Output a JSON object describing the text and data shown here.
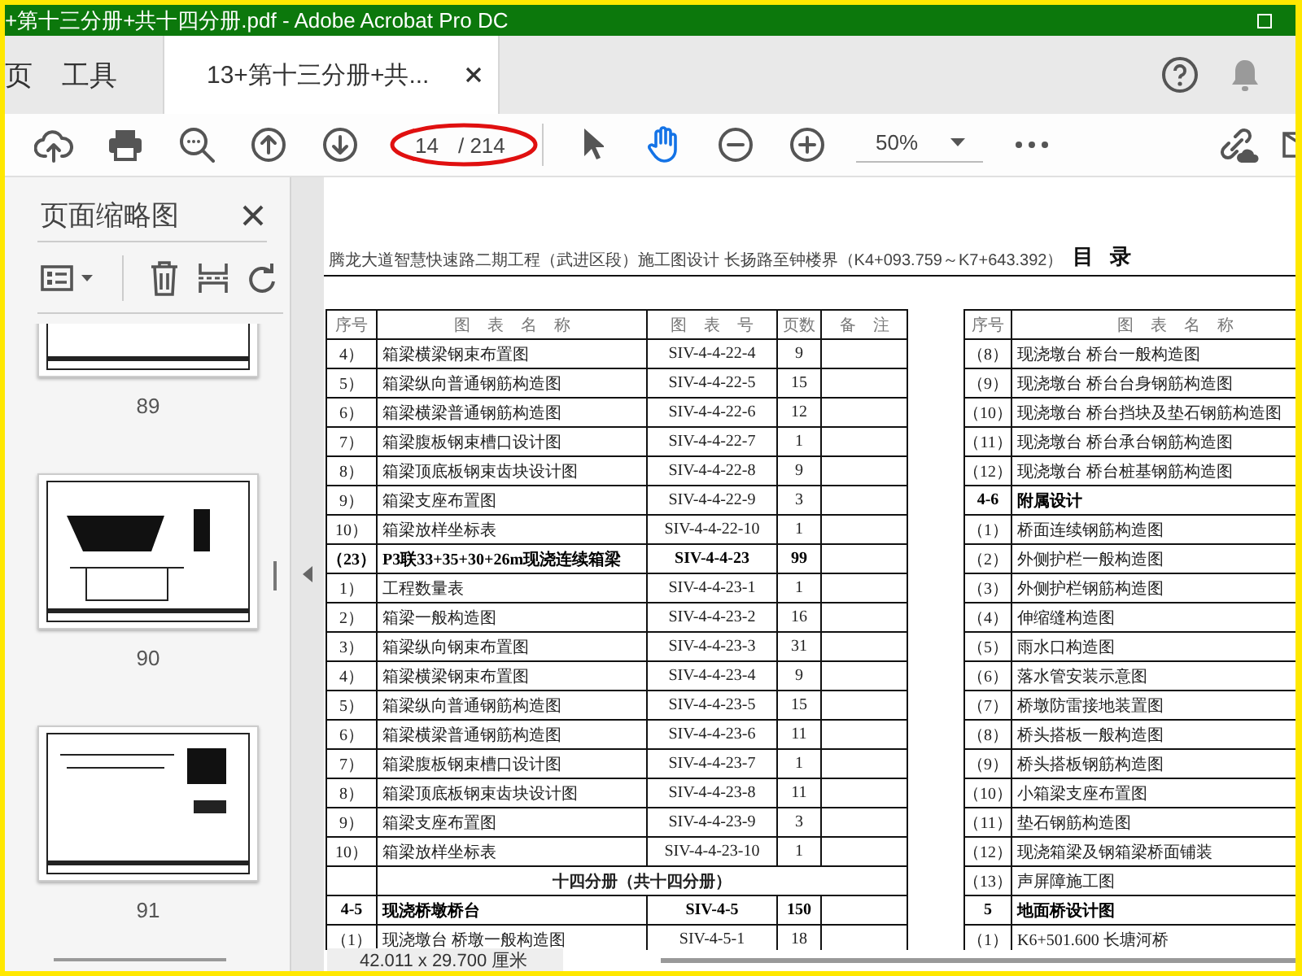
{
  "window": {
    "title": "+第十三分册+共十四分册.pdf - Adobe Acrobat Pro DC"
  },
  "tabs": [
    {
      "label": "页",
      "selected": false
    },
    {
      "label": "工具",
      "selected": false
    },
    {
      "label": "13+第十三分册+共...",
      "selected": true
    }
  ],
  "toolbar": {
    "page_current": "14",
    "page_total": "/ 214",
    "zoom": "50%"
  },
  "thumbnails_panel": {
    "title": "页面缩略图",
    "pages": [
      {
        "label": "89"
      },
      {
        "label": "90"
      },
      {
        "label": "91"
      }
    ]
  },
  "document": {
    "header": "腾龙大道智慧快速路二期工程（武进区段）施工图设计 长扬路至钟楼界（K4+093.759～K7+643.392）",
    "header_title": "目 录",
    "left_table": {
      "columns": [
        "序号",
        "图 表 名 称",
        "图 表 号",
        "页数",
        "备 注"
      ],
      "rows": [
        {
          "kind": "item",
          "seq": "4）",
          "name": "箱梁横梁钢束布置图",
          "code": "SIV-4-4-22-4",
          "pages": "9"
        },
        {
          "kind": "item",
          "seq": "5）",
          "name": "箱梁纵向普通钢筋构造图",
          "code": "SIV-4-4-22-5",
          "pages": "15"
        },
        {
          "kind": "item",
          "seq": "6）",
          "name": "箱梁横梁普通钢筋构造图",
          "code": "SIV-4-4-22-6",
          "pages": "12"
        },
        {
          "kind": "item",
          "seq": "7）",
          "name": "箱梁腹板钢束槽口设计图",
          "code": "SIV-4-4-22-7",
          "pages": "1"
        },
        {
          "kind": "item",
          "seq": "8）",
          "name": "箱梁顶底板钢束齿块设计图",
          "code": "SIV-4-4-22-8",
          "pages": "9"
        },
        {
          "kind": "item",
          "seq": "9）",
          "name": "箱梁支座布置图",
          "code": "SIV-4-4-22-9",
          "pages": "3"
        },
        {
          "kind": "item",
          "seq": "10）",
          "name": "箱梁放样坐标表",
          "code": "SIV-4-4-22-10",
          "pages": "1"
        },
        {
          "kind": "section",
          "seq": "（23）",
          "name": "P3联33+35+30+26m现浇连续箱梁",
          "code": "SIV-4-4-23",
          "pages": "99"
        },
        {
          "kind": "item",
          "seq": "1）",
          "name": "工程数量表",
          "code": "SIV-4-4-23-1",
          "pages": "1"
        },
        {
          "kind": "item",
          "seq": "2）",
          "name": "箱梁一般构造图",
          "code": "SIV-4-4-23-2",
          "pages": "16"
        },
        {
          "kind": "item",
          "seq": "3）",
          "name": "箱梁纵向钢束布置图",
          "code": "SIV-4-4-23-3",
          "pages": "31"
        },
        {
          "kind": "item",
          "seq": "4）",
          "name": "箱梁横梁钢束布置图",
          "code": "SIV-4-4-23-4",
          "pages": "9"
        },
        {
          "kind": "item",
          "seq": "5）",
          "name": "箱梁纵向普通钢筋构造图",
          "code": "SIV-4-4-23-5",
          "pages": "15"
        },
        {
          "kind": "item",
          "seq": "6）",
          "name": "箱梁横梁普通钢筋构造图",
          "code": "SIV-4-4-23-6",
          "pages": "11"
        },
        {
          "kind": "item",
          "seq": "7）",
          "name": "箱梁腹板钢束槽口设计图",
          "code": "SIV-4-4-23-7",
          "pages": "1"
        },
        {
          "kind": "item",
          "seq": "8）",
          "name": "箱梁顶底板钢束齿块设计图",
          "code": "SIV-4-4-23-8",
          "pages": "11"
        },
        {
          "kind": "item",
          "seq": "9）",
          "name": "箱梁支座布置图",
          "code": "SIV-4-4-23-9",
          "pages": "3"
        },
        {
          "kind": "item",
          "seq": "10）",
          "name": "箱梁放样坐标表",
          "code": "SIV-4-4-23-10",
          "pages": "1"
        },
        {
          "kind": "heading",
          "name": "十四分册（共十四分册）"
        },
        {
          "kind": "section",
          "seq": "4-5",
          "name": "现浇桥墩桥台",
          "code": "SIV-4-5",
          "pages": "150"
        },
        {
          "kind": "item",
          "seq": "（1）",
          "name": "现浇墩台 桥墩一般构造图",
          "code": "SIV-4-5-1",
          "pages": "18"
        }
      ]
    },
    "right_table": {
      "columns": [
        "序号",
        "图 表 名 称"
      ],
      "rows": [
        {
          "kind": "item",
          "seq": "（8）",
          "name": "现浇墩台 桥台一般构造图"
        },
        {
          "kind": "item",
          "seq": "（9）",
          "name": "现浇墩台 桥台台身钢筋构造图"
        },
        {
          "kind": "item",
          "seq": "（10）",
          "name": "现浇墩台 桥台挡块及垫石钢筋构造图"
        },
        {
          "kind": "item",
          "seq": "（11）",
          "name": "现浇墩台 桥台承台钢筋构造图"
        },
        {
          "kind": "item",
          "seq": "（12）",
          "name": "现浇墩台 桥台桩基钢筋构造图"
        },
        {
          "kind": "section",
          "seq": "4-6",
          "name": "附属设计"
        },
        {
          "kind": "item",
          "seq": "（1）",
          "name": "桥面连续钢筋构造图"
        },
        {
          "kind": "item",
          "seq": "（2）",
          "name": "外侧护栏一般构造图"
        },
        {
          "kind": "item",
          "seq": "（3）",
          "name": "外侧护栏钢筋构造图"
        },
        {
          "kind": "item",
          "seq": "（4）",
          "name": "伸缩缝构造图"
        },
        {
          "kind": "item",
          "seq": "（5）",
          "name": "雨水口构造图"
        },
        {
          "kind": "item",
          "seq": "（6）",
          "name": "落水管安装示意图"
        },
        {
          "kind": "item",
          "seq": "（7）",
          "name": "桥墩防雷接地装置图"
        },
        {
          "kind": "item",
          "seq": "（8）",
          "name": "桥头搭板一般构造图"
        },
        {
          "kind": "item",
          "seq": "（9）",
          "name": "桥头搭板钢筋构造图"
        },
        {
          "kind": "item",
          "seq": "（10）",
          "name": "小箱梁支座布置图"
        },
        {
          "kind": "item",
          "seq": "（11）",
          "name": "垫石钢筋构造图"
        },
        {
          "kind": "item",
          "seq": "（12）",
          "name": "现浇箱梁及钢箱梁桥面铺装"
        },
        {
          "kind": "item",
          "seq": "（13）",
          "name": "声屏障施工图"
        },
        {
          "kind": "section",
          "seq": "5",
          "name": "地面桥设计图"
        },
        {
          "kind": "item",
          "seq": "（1）",
          "name": "K6+501.600 长塘河桥"
        }
      ]
    }
  },
  "status_bar": {
    "page_size": "42.011 x 29.700 厘米"
  }
}
